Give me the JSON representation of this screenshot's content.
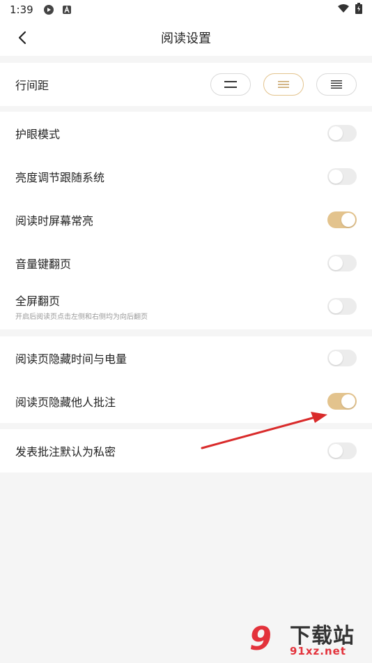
{
  "status_bar": {
    "time": "1:39",
    "icons_left": [
      "tencent-video-icon",
      "a-icon"
    ],
    "icons_right": [
      "wifi-icon",
      "battery-icon"
    ]
  },
  "header": {
    "title": "阅读设置",
    "back_icon": "chevron-left-icon"
  },
  "line_spacing": {
    "label": "行间距",
    "options": [
      "narrow",
      "medium",
      "wide"
    ],
    "selected": "medium"
  },
  "settings_group1": [
    {
      "label": "护眼模式",
      "sub": "",
      "on": false
    },
    {
      "label": "亮度调节跟随系统",
      "sub": "",
      "on": false
    },
    {
      "label": "阅读时屏幕常亮",
      "sub": "",
      "on": true
    },
    {
      "label": "音量键翻页",
      "sub": "",
      "on": false
    },
    {
      "label": "全屏翻页",
      "sub": "开启后阅读页点击左侧和右侧均为向后翻页",
      "on": false
    }
  ],
  "settings_group2": [
    {
      "label": "阅读页隐藏时间与电量",
      "on": false
    },
    {
      "label": "阅读页隐藏他人批注",
      "on": true
    }
  ],
  "settings_group3": [
    {
      "label": "发表批注默认为私密",
      "on": false
    }
  ],
  "colors": {
    "accent": "#e3c38d",
    "toggle_off": "#ececec",
    "arrow": "#d92b2b"
  },
  "watermark": {
    "logo": "9",
    "text1": "下载站",
    "text2": "91xz.net"
  }
}
